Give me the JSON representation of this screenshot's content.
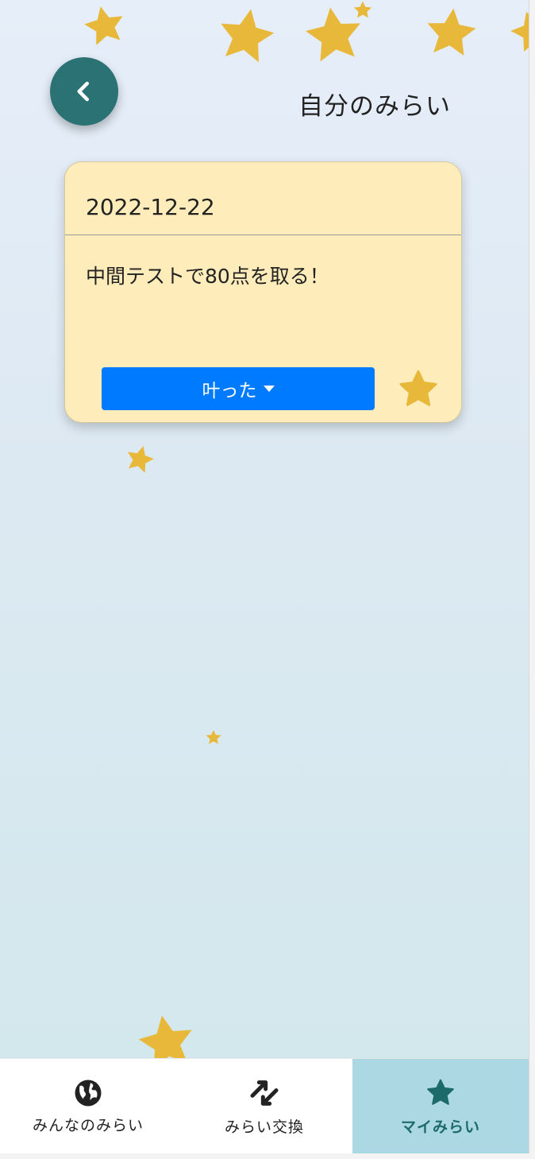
{
  "header": {
    "title": "自分のみらい",
    "back_icon": "chevron-left-icon"
  },
  "card": {
    "date": "2022-12-22",
    "goal": "中間テストで80点を取る！",
    "status_label": "叶った",
    "favorite_icon": "star-icon"
  },
  "tabs": [
    {
      "label": "みんなのみらい",
      "icon": "globe-icon",
      "active": false
    },
    {
      "label": "みらい交換",
      "icon": "exchange-arrows-icon",
      "active": false
    },
    {
      "label": "マイみらい",
      "icon": "star-icon",
      "active": true
    }
  ],
  "colors": {
    "accent": "#2a7273",
    "star": "#e8b83a",
    "card_bg": "#ffecbb",
    "button": "#007bff",
    "active_tab_bg": "#acd8e4"
  }
}
